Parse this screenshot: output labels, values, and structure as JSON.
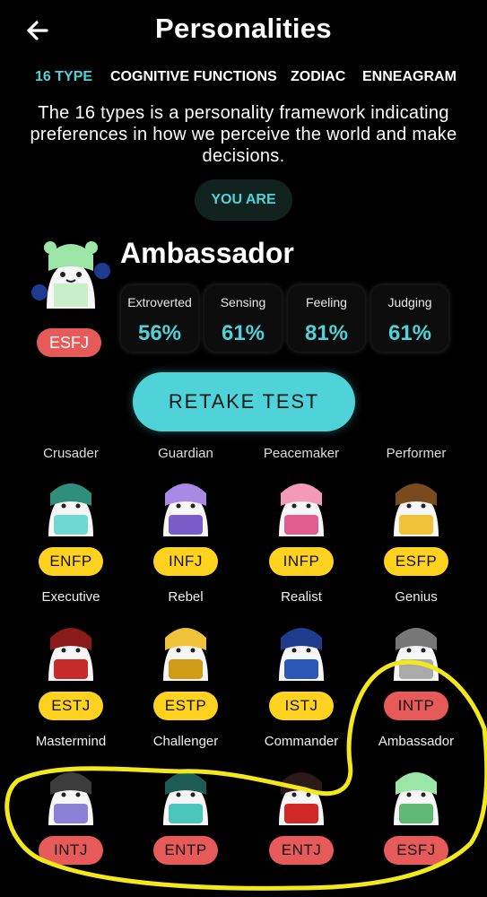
{
  "header": {
    "title": "Personalities",
    "back_icon": "arrow-left-icon"
  },
  "tabs": [
    {
      "label": "16 TYPE",
      "active": true
    },
    {
      "label": "COGNITIVE FUNCTIONS",
      "active": false
    },
    {
      "label": "ZODIAC",
      "active": false
    },
    {
      "label": "ENNEAGRAM",
      "active": false
    }
  ],
  "intro": "The 16 types is a personality framework indicating preferences in how we perceive the world and make decisions.",
  "you_are_label": "YOU ARE",
  "result": {
    "name": "Ambassador",
    "type": "ESFJ",
    "traits": [
      {
        "name": "Extroverted",
        "value": "56%"
      },
      {
        "name": "Sensing",
        "value": "61%"
      },
      {
        "name": "Feeling",
        "value": "81%"
      },
      {
        "name": "Judging",
        "value": "61%"
      }
    ]
  },
  "retake_label": "RETAKE TEST",
  "grid": {
    "cut_labels": [
      "Crusader",
      "Guardian",
      "Peacemaker",
      "Performer"
    ],
    "rows": [
      {
        "items": [
          {
            "type": "ENFP",
            "color": "yellow",
            "avatar": "elf-character-icon"
          },
          {
            "type": "INFJ",
            "color": "yellow",
            "avatar": "wizard-character-icon"
          },
          {
            "type": "INFP",
            "color": "yellow",
            "avatar": "pink-hair-character-icon"
          },
          {
            "type": "ESFP",
            "color": "yellow",
            "avatar": "performer-character-icon"
          }
        ],
        "next_labels": [
          "Executive",
          "Rebel",
          "Realist",
          "Genius"
        ]
      },
      {
        "items": [
          {
            "type": "ESTJ",
            "color": "yellow",
            "avatar": "red-hood-character-icon"
          },
          {
            "type": "ESTP",
            "color": "yellow",
            "avatar": "hardhat-character-icon"
          },
          {
            "type": "ISTJ",
            "color": "yellow",
            "avatar": "officer-character-icon"
          },
          {
            "type": "INTP",
            "color": "red",
            "avatar": "scientist-character-icon"
          }
        ],
        "next_labels": [
          "Mastermind",
          "Challenger",
          "Commander",
          "Ambassador"
        ]
      },
      {
        "items": [
          {
            "type": "INTJ",
            "color": "red",
            "avatar": "mastermind-character-icon"
          },
          {
            "type": "ENTP",
            "color": "red",
            "avatar": "challenger-character-icon"
          },
          {
            "type": "ENTJ",
            "color": "red",
            "avatar": "commander-character-icon"
          },
          {
            "type": "ESFJ",
            "color": "red",
            "avatar": "ambassador-character-icon"
          }
        ],
        "next_labels": []
      }
    ]
  },
  "colors": {
    "accent": "#4fd3d8",
    "yellow_badge": "#ffd21f",
    "red_badge": "#e65a5a",
    "highlight": "#f2e81c"
  }
}
